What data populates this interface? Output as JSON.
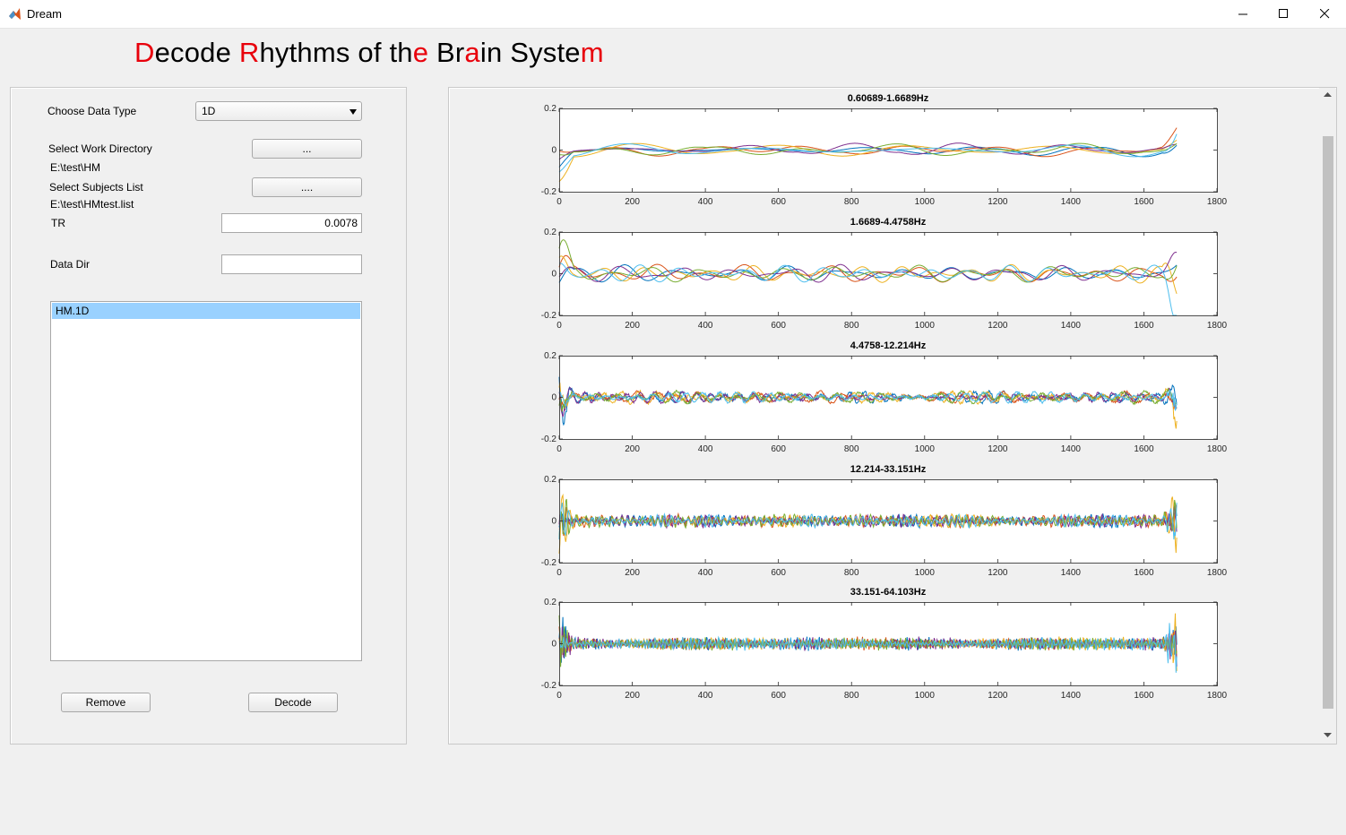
{
  "window": {
    "title": "Dream",
    "controls": [
      "minimize-icon",
      "maximize-icon",
      "close-icon"
    ]
  },
  "heading": {
    "segments": [
      {
        "text": "D",
        "red": true
      },
      {
        "text": "ecode ",
        "red": false
      },
      {
        "text": "R",
        "red": true
      },
      {
        "text": "hythms of th",
        "red": false
      },
      {
        "text": "e",
        "red": true
      },
      {
        "text": " Br",
        "red": false
      },
      {
        "text": "a",
        "red": true
      },
      {
        "text": "in Syste",
        "red": false
      },
      {
        "text": "m",
        "red": true
      }
    ]
  },
  "form": {
    "data_type_label": "Choose Data Type",
    "data_type_value": "1D",
    "work_dir_label": "Select Work Directory",
    "work_dir_button": "...",
    "work_dir_value": "E:\\test\\HM",
    "subjects_label": "Select Subjects List",
    "subjects_button": "....",
    "subjects_value": "E:\\test\\HMtest.list",
    "tr_label": "TR",
    "tr_value": "0.0078",
    "data_dir_label": "Data Dir",
    "data_dir_value": "",
    "list_items": [
      "HM.1D"
    ],
    "remove_button": "Remove",
    "decode_button": "Decode"
  },
  "colors": {
    "heading_red": "#e8000b",
    "selection": "#99d1ff",
    "series": [
      "#0072bd",
      "#d95319",
      "#edb120",
      "#7e2f8e",
      "#77ac30",
      "#4dbeee"
    ]
  },
  "chart_data": [
    {
      "type": "line",
      "title": "0.60689-1.6689Hz",
      "xlim": [
        0,
        1800
      ],
      "ylim": [
        -0.2,
        0.2
      ],
      "xticks": [
        "0",
        "200",
        "400",
        "600",
        "800",
        "1000",
        "1200",
        "1400",
        "1600",
        "1800"
      ],
      "yticks": [
        "0.2",
        "0",
        "-0.2"
      ],
      "series_count": 6,
      "samples": 1690,
      "typical_amplitude": 0.035,
      "band_index": 0
    },
    {
      "type": "line",
      "title": "1.6689-4.4758Hz",
      "xlim": [
        0,
        1800
      ],
      "ylim": [
        -0.2,
        0.2
      ],
      "xticks": [
        "0",
        "200",
        "400",
        "600",
        "800",
        "1000",
        "1200",
        "1400",
        "1600",
        "1800"
      ],
      "yticks": [
        "0.2",
        "0",
        "-0.2"
      ],
      "series_count": 6,
      "samples": 1690,
      "typical_amplitude": 0.045,
      "band_index": 1
    },
    {
      "type": "line",
      "title": "4.4758-12.214Hz",
      "xlim": [
        0,
        1800
      ],
      "ylim": [
        -0.2,
        0.2
      ],
      "xticks": [
        "0",
        "200",
        "400",
        "600",
        "800",
        "1000",
        "1200",
        "1400",
        "1600",
        "1800"
      ],
      "yticks": [
        "0.2",
        "0",
        "-0.2"
      ],
      "series_count": 6,
      "samples": 1690,
      "typical_amplitude": 0.03,
      "band_index": 2
    },
    {
      "type": "line",
      "title": "12.214-33.151Hz",
      "xlim": [
        0,
        1800
      ],
      "ylim": [
        -0.2,
        0.2
      ],
      "xticks": [
        "0",
        "200",
        "400",
        "600",
        "800",
        "1000",
        "1200",
        "1400",
        "1600",
        "1800"
      ],
      "yticks": [
        "0.2",
        "0",
        "-0.2"
      ],
      "series_count": 6,
      "samples": 1690,
      "typical_amplitude": 0.03,
      "band_index": 3
    },
    {
      "type": "line",
      "title": "33.151-64.103Hz",
      "xlim": [
        0,
        1800
      ],
      "ylim": [
        -0.2,
        0.2
      ],
      "xticks": [
        "0",
        "200",
        "400",
        "600",
        "800",
        "1000",
        "1200",
        "1400",
        "1600",
        "1800"
      ],
      "yticks": [
        "0.2",
        "0",
        "-0.2"
      ],
      "series_count": 6,
      "samples": 1690,
      "typical_amplitude": 0.03,
      "band_index": 4
    }
  ]
}
